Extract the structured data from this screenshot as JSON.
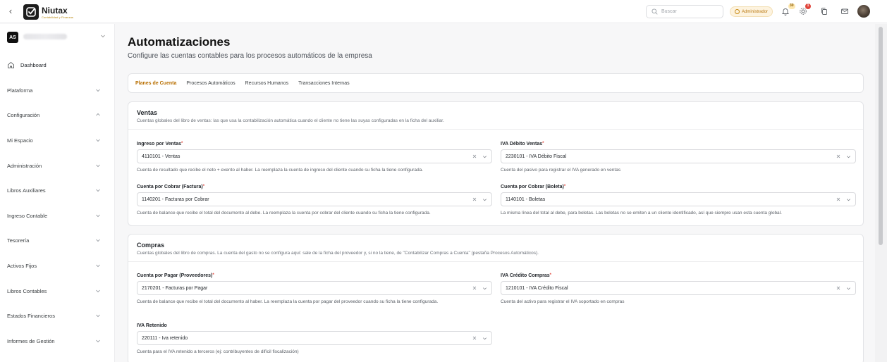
{
  "header": {
    "brand_name": "Niutax",
    "brand_tagline": "Contabilidad y Finanzas",
    "search_placeholder": "Buscar",
    "role_badge": "Administrador",
    "notifications_count": "30",
    "alerts_count": "1"
  },
  "sidebar": {
    "org_initials": "AS",
    "items": [
      {
        "label": "Dashboard"
      },
      {
        "label": "Plataforma"
      },
      {
        "label": "Configuración"
      },
      {
        "label": "Mi Espacio"
      },
      {
        "label": "Administración"
      },
      {
        "label": "Libros Auxiliares"
      },
      {
        "label": "Ingreso Contable"
      },
      {
        "label": "Tesorería"
      },
      {
        "label": "Activos Fijos"
      },
      {
        "label": "Libros Contables"
      },
      {
        "label": "Estados Financieros"
      },
      {
        "label": "Informes de Gestión"
      }
    ]
  },
  "page": {
    "title": "Automatizaciones",
    "subtitle": "Configure las cuentas contables para los procesos automáticos de la empresa"
  },
  "tabs": [
    {
      "label": "Planes de Cuenta",
      "active": true
    },
    {
      "label": "Procesos Automáticos",
      "active": false
    },
    {
      "label": "Recursos Humanos",
      "active": false
    },
    {
      "label": "Transacciones Internas",
      "active": false
    }
  ],
  "ventas": {
    "title": "Ventas",
    "description": "Cuentas globales del libro de ventas: las que usa la contabilización automática cuando el cliente no tiene las suyas configuradas en la ficha del auxiliar.",
    "fields": [
      {
        "label": "Ingreso por Ventas",
        "value": "4110101 - Ventas",
        "help": "Cuenta de resultado que recibe el neto + exento al haber. La reemplaza la cuenta de ingreso del cliente cuando su ficha la tiene configurada."
      },
      {
        "label": "IVA Débito Ventas",
        "value": "2230101 - IVA Débito Fiscal",
        "help": "Cuenta del pasivo para registrar el IVA generado en ventas"
      },
      {
        "label": "Cuenta por Cobrar (Factura)",
        "value": "1140201 - Facturas por Cobrar",
        "help": "Cuenta de balance que recibe el total del documento al debe. La reemplaza la cuenta por cobrar del cliente cuando su ficha la tiene configurada."
      },
      {
        "label": "Cuenta por Cobrar (Boleta)",
        "value": "1140101 - Boletas",
        "help": "La misma línea del total al debe, para boletas. Las boletas no se emiten a un cliente identificado, así que siempre usan esta cuenta global."
      }
    ]
  },
  "compras": {
    "title": "Compras",
    "description": "Cuentas globales del libro de compras. La cuenta del gasto no se configura aquí: sale de la ficha del proveedor y, si no la tiene, de \"Contabilizar Compras a Cuenta\" (pestaña Procesos Automáticos).",
    "fields": [
      {
        "label": "Cuenta por Pagar (Proveedores)",
        "value": "2170201 - Facturas por Pagar",
        "help": "Cuenta de balance que recibe el total del documento al haber. La reemplaza la cuenta por pagar del proveedor cuando su ficha la tiene configurada."
      },
      {
        "label": "IVA Crédito Compras",
        "value": "1210101 - IVA Crédito Fiscal",
        "help": "Cuenta del activo para registrar el IVA soportado en compras"
      },
      {
        "label": "IVA Retenido",
        "value": "220111 - Iva retenido",
        "help": "Cuenta para el IVA retenido a terceros (ej: contribuyentes de difícil fiscalización)"
      }
    ]
  }
}
